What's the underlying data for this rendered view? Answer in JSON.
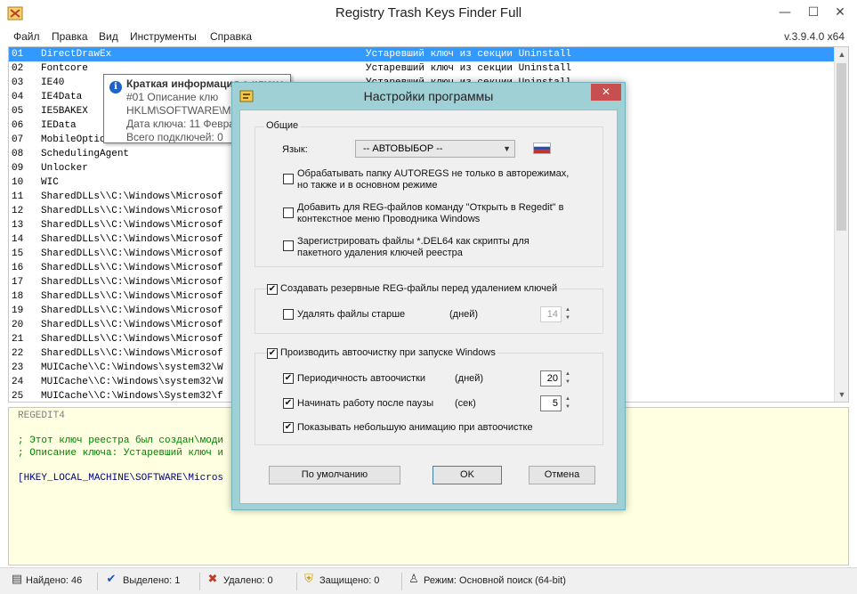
{
  "app": {
    "title": "Registry Trash Keys Finder Full",
    "version": "v.3.9.4.0 x64"
  },
  "menu": [
    "Файл",
    "Правка",
    "Вид",
    "Инструменты",
    "Справка"
  ],
  "list": {
    "rows": [
      {
        "num": "01",
        "key": "DirectDrawEx",
        "desc": "Устаревший ключ из секции Uninstall"
      },
      {
        "num": "02",
        "key": "Fontcore",
        "desc": "Устаревший ключ из секции Uninstall"
      },
      {
        "num": "03",
        "key": "IE40",
        "desc": "Устаревший ключ из секции Uninstall"
      },
      {
        "num": "04",
        "key": "IE4Data",
        "desc": ""
      },
      {
        "num": "05",
        "key": "IE5BAKEX",
        "desc": ""
      },
      {
        "num": "06",
        "key": "IEData",
        "desc": ""
      },
      {
        "num": "07",
        "key": "MobileOptionPack",
        "desc": ""
      },
      {
        "num": "08",
        "key": "SchedulingAgent",
        "desc": ""
      },
      {
        "num": "09",
        "key": "Unlocker",
        "desc": ""
      },
      {
        "num": "10",
        "key": "WIC",
        "desc": ""
      },
      {
        "num": "11",
        "key": "SharedDLLs\\\\C:\\Windows\\Microsof",
        "desc": ""
      },
      {
        "num": "12",
        "key": "SharedDLLs\\\\C:\\Windows\\Microsof",
        "desc": ""
      },
      {
        "num": "13",
        "key": "SharedDLLs\\\\C:\\Windows\\Microsof",
        "desc": ""
      },
      {
        "num": "14",
        "key": "SharedDLLs\\\\C:\\Windows\\Microsof",
        "desc": ""
      },
      {
        "num": "15",
        "key": "SharedDLLs\\\\C:\\Windows\\Microsof",
        "desc": ""
      },
      {
        "num": "16",
        "key": "SharedDLLs\\\\C:\\Windows\\Microsof",
        "desc": ""
      },
      {
        "num": "17",
        "key": "SharedDLLs\\\\C:\\Windows\\Microsof",
        "desc": ""
      },
      {
        "num": "18",
        "key": "SharedDLLs\\\\C:\\Windows\\Microsof",
        "desc": ""
      },
      {
        "num": "19",
        "key": "SharedDLLs\\\\C:\\Windows\\Microsof",
        "desc": ""
      },
      {
        "num": "20",
        "key": "SharedDLLs\\\\C:\\Windows\\Microsof",
        "desc": ""
      },
      {
        "num": "21",
        "key": "SharedDLLs\\\\C:\\Windows\\Microsof",
        "desc": ""
      },
      {
        "num": "22",
        "key": "SharedDLLs\\\\C:\\Windows\\Microsof",
        "desc": ""
      },
      {
        "num": "23",
        "key": "MUICache\\\\C:\\Windows\\system32\\W",
        "desc": ""
      },
      {
        "num": "24",
        "key": "MUICache\\\\C:\\Windows\\system32\\W",
        "desc": ""
      },
      {
        "num": "25",
        "key": "MUICache\\\\C:\\Windows\\System32\\f",
        "desc": ""
      }
    ]
  },
  "tooltip": {
    "title": "Краткая информация о ключе:",
    "line1": "#01        Описание клю",
    "line2": "HKLM\\SOFTWARE\\Mic",
    "line3": "Дата ключа: 11 Февра",
    "line4": "Всего подключей: 0"
  },
  "regpane": {
    "header": "REGEDIT4",
    "comment1": "; Этот ключ реестра был создан\\моди",
    "comment2": "; Описание ключа: Устаревший ключ и",
    "keyline": "[HKEY_LOCAL_MACHINE\\SOFTWARE\\Micros"
  },
  "status": {
    "found": "Найдено: 46",
    "selected": "Выделено: 1",
    "deleted": "Удалено: 0",
    "protected": "Защищено: 0",
    "mode": "Режим: Основной поиск (64-bit)"
  },
  "dialog": {
    "title": "Настройки программы",
    "close_label": "✕",
    "general": {
      "label": "Общие",
      "language_label": "Язык:",
      "language_value": "-- АВТОВЫБОР --",
      "opt1_line1": "Обрабатывать папку AUTOREGS не только в авторежимах,",
      "opt1_line2": "но также и в основном режиме",
      "opt1_checked": false,
      "opt2_line1": "Добавить для REG-файлов команду \"Открыть в Regedit\" в",
      "opt2_line2": "контекстное меню Проводника Windows",
      "opt2_checked": false,
      "opt3_line1": "Зарегистрировать файлы *.DEL64 как скрипты для",
      "opt3_line2": "пакетного удаления ключей реестра",
      "opt3_checked": false
    },
    "backup": {
      "label": "Создавать резервные REG-файлы перед удалением ключей",
      "checked": true,
      "delete_old_label": "Удалять файлы старше",
      "delete_old_checked": false,
      "days_label": "(дней)",
      "days_value": "14"
    },
    "autoclean": {
      "label": "Производить автоочистку при запуске Windows",
      "checked": true,
      "period_label": "Периодичность автоочистки",
      "period_checked": true,
      "period_unit": "(дней)",
      "period_value": "20",
      "delay_label": "Начинать работу после паузы",
      "delay_checked": true,
      "delay_unit": "(сек)",
      "delay_value": "5",
      "anim_label": "Показывать небольшую анимацию при автоочистке",
      "anim_checked": true
    },
    "buttons": {
      "default": "По умолчанию",
      "ok": "OK",
      "cancel": "Отмена"
    }
  },
  "colors": {
    "selection": "#3399ff",
    "dialog_frame": "#9ed0d6",
    "reg_pane_bg": "#ffffe1",
    "reg_comment": "#008000",
    "reg_key": "#000080"
  }
}
